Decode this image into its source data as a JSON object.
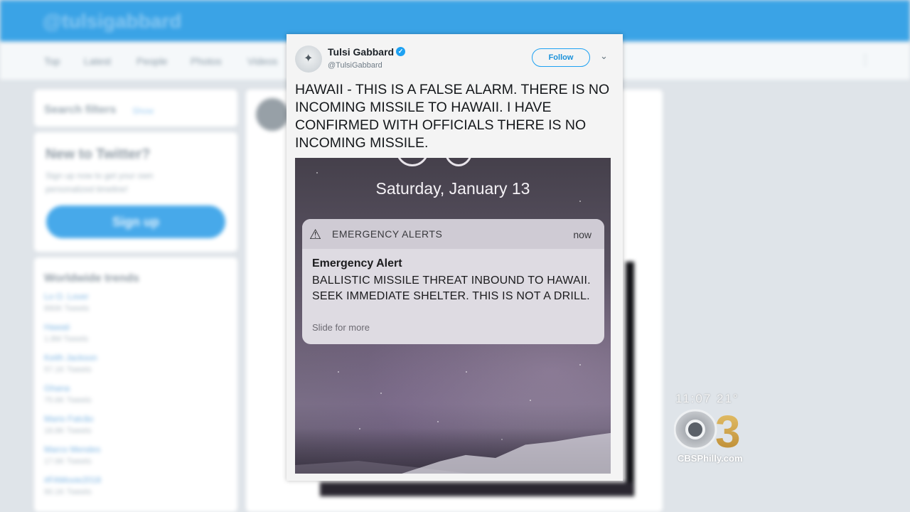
{
  "background": {
    "handle": "@tulsigabbard",
    "nav_items": [
      "Top",
      "Latest",
      "People",
      "Photos",
      "Videos"
    ],
    "search_filters": {
      "title": "Search filters",
      "edit": "Show"
    },
    "new_to_twitter": {
      "title": "New to Twitter?",
      "text": "Sign up now to get your own personalized timeline!",
      "signup": "Sign up"
    },
    "trends": {
      "title": "Worldwide trends",
      "items": [
        {
          "name": "Lo O. Lover",
          "count": "890K Tweets"
        },
        {
          "name": "Hawaii",
          "count": "1.8M Tweets"
        },
        {
          "name": "Keith Jackson",
          "count": "57.1K Tweets"
        },
        {
          "name": "Ghana",
          "count": "75.6K Tweets"
        },
        {
          "name": "Mario Falcão",
          "count": "18.8K Tweets"
        },
        {
          "name": "Marco Mendes",
          "count": "17.6K Tweets"
        },
        {
          "name": "#FAMovie2018",
          "count": "90.1K Tweets"
        }
      ]
    }
  },
  "tweet": {
    "display_name": "Tulsi Gabbard",
    "handle": "@TulsiGabbard",
    "follow_label": "Follow",
    "text": "HAWAII - THIS IS A FALSE ALARM. THERE IS NO INCOMING MISSILE TO HAWAII. I HAVE CONFIRMED WITH OFFICIALS THERE IS NO INCOMING MISSILE.",
    "photo": {
      "date": "Saturday, January 13",
      "notification": {
        "app": "EMERGENCY ALERTS",
        "time": "now",
        "title": "Emergency Alert",
        "body": "BALLISTIC MISSILE THREAT INBOUND TO HAWAII. SEEK IMMEDIATE SHELTER. THIS IS NOT A DRILL.",
        "more": "Slide for more"
      }
    }
  },
  "station": {
    "time": "11:07 21°",
    "site": "CBSPhilly.com",
    "channel": "3"
  },
  "colors": {
    "twitter_blue": "#1da1f2",
    "header_blue": "#3aa3e6",
    "logo_gold": "#c99a3a"
  }
}
